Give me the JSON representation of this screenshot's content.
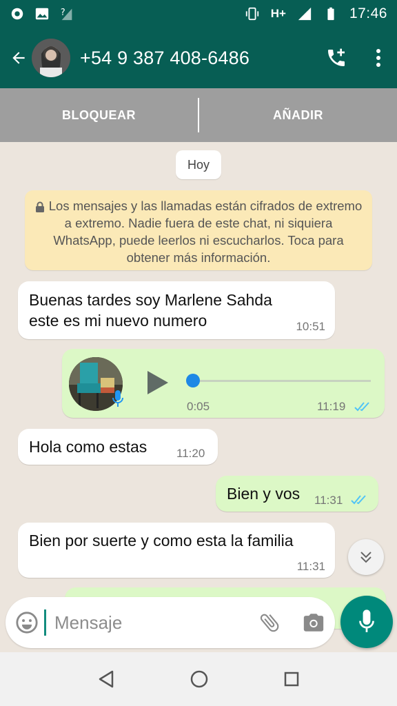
{
  "status_bar": {
    "time": "17:46",
    "network": "H+"
  },
  "header": {
    "contact": "+54 9 387 408-6486"
  },
  "actions": {
    "block": "BLOQUEAR",
    "add": "AÑADIR"
  },
  "chat": {
    "date": "Hoy",
    "encryption_notice": "Los mensajes y las llamadas están cifrados de extremo a extremo. Nadie fuera de este chat, ni siquiera WhatsApp, puede leerlos ni escucharlos. Toca para obtener más información.",
    "messages": [
      {
        "direction": "in",
        "text_line1": "Buenas tardes soy Marlene Sahda",
        "text_line2": "este es mi nuevo numero",
        "time": "10:51"
      },
      {
        "direction": "out",
        "type": "voice",
        "duration": "0:05",
        "time": "11:19"
      },
      {
        "direction": "in",
        "text": "Hola como estas",
        "time": "11:20"
      },
      {
        "direction": "out",
        "text": "Bien y vos",
        "time": "11:31"
      },
      {
        "direction": "in",
        "text": "Bien por suerte y como esta la familia",
        "time": "11:31"
      }
    ]
  },
  "composer": {
    "placeholder": "Mensaje"
  },
  "colors": {
    "header": "#075e54",
    "outgoing": "#dcf8c6",
    "accent": "#00897b",
    "read_ticks": "#4fc3f7"
  },
  "icons": [
    "back-arrow-icon",
    "add-call-icon",
    "more-vert-icon",
    "lock-icon",
    "play-icon",
    "mic-icon",
    "emoji-icon",
    "attach-icon",
    "camera-icon",
    "scroll-down-icon",
    "nav-back-icon",
    "nav-home-icon",
    "nav-recents-icon"
  ]
}
